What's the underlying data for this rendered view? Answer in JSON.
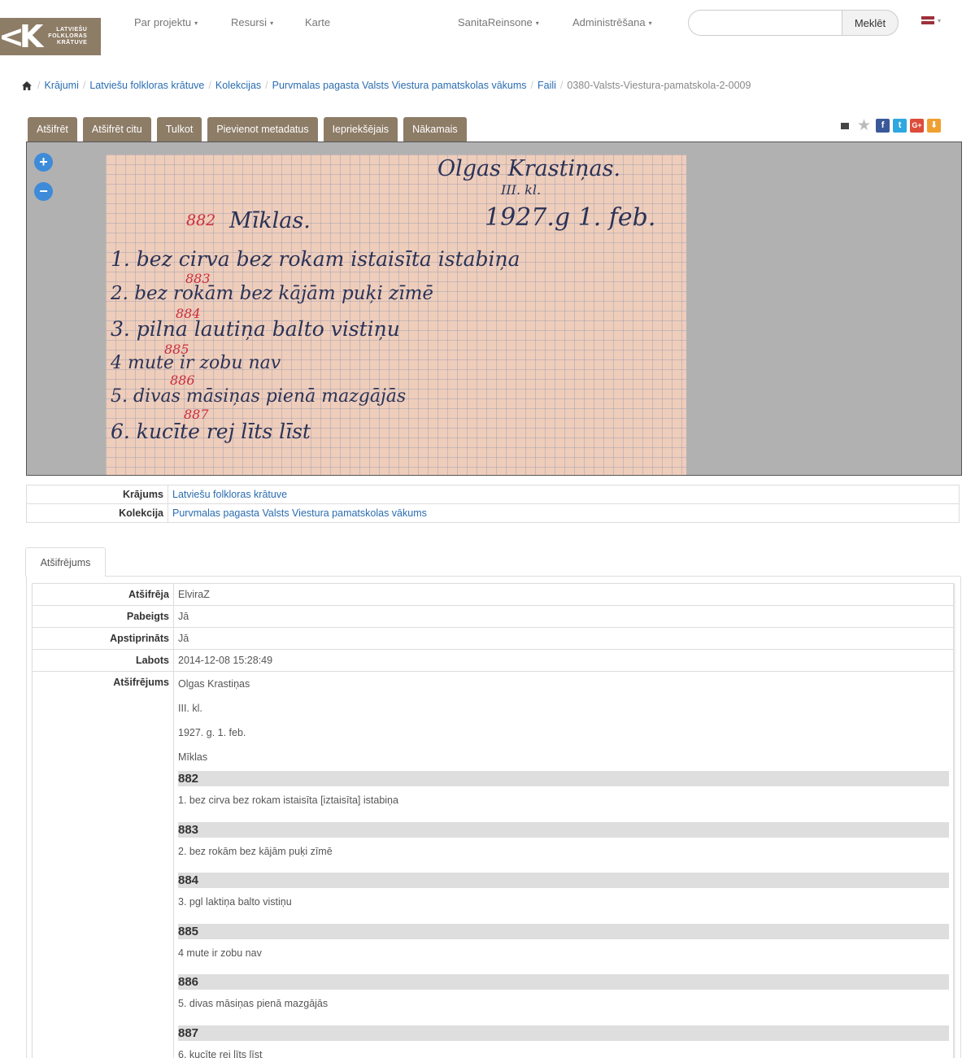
{
  "nav": {
    "logo_text_1": "LATVIEŠU",
    "logo_text_2": "FOLKLORAS",
    "logo_text_3": "KRĀTUVE",
    "items": [
      "Par projektu",
      "Resursi",
      "Karte"
    ],
    "user": "SanitaReinsone",
    "admin": "Administrēšana",
    "search_placeholder": "",
    "search_button": "Meklēt"
  },
  "breadcrumb": {
    "items": [
      "Krājumi",
      "Latviešu folkloras krātuve",
      "Kolekcijas",
      "Purvmalas pagasta Valsts Viestura pamatskolas vākums",
      "Faili"
    ],
    "current": "0380-Valsts-Viestura-pamatskola-2-0009"
  },
  "actions": [
    "Atšifrēt",
    "Atšifrēt citu",
    "Tulkot",
    "Pievienot metadatus",
    "Iepriekšējais",
    "Nākamais"
  ],
  "share": {
    "facebook": "f",
    "twitter": "t",
    "google": "G+"
  },
  "viewer": {
    "zoom_in": "+",
    "zoom_out": "−",
    "manuscript": {
      "name": "Olgas Krastiņas.",
      "class": "III. kl.",
      "date": "1927.g 1. feb.",
      "heading": "Mīklas.",
      "heading_num": "882",
      "lines": [
        "1. bez cirva bez rokam istaisīta istabiņa",
        "2. bez rokām bez kājām puķi zīmē",
        "3. pilna lautiņa balto vistiņu",
        "4 mute ir zobu nav",
        "5. divas māsiņas pienā mazgājās",
        "6. kucīte rej līts līst"
      ],
      "red_nums": [
        "883",
        "884",
        "885",
        "886",
        "887"
      ]
    }
  },
  "info": [
    {
      "label": "Krājums",
      "value": "Latviešu folkloras krātuve"
    },
    {
      "label": "Kolekcija",
      "value": "Purvmalas pagasta Valsts Viestura pamatskolas vākums"
    }
  ],
  "tab": "Atšifrējums",
  "transcription": {
    "fields": [
      {
        "label": "Atšifrēja",
        "value": "ElviraZ"
      },
      {
        "label": "Pabeigts",
        "value": "Jā"
      },
      {
        "label": "Apstiprināts",
        "value": "Jā"
      },
      {
        "label": "Labots",
        "value": "2014-12-08 15:28:49"
      }
    ],
    "text_label": "Atšifrējums",
    "header_lines": [
      "Olgas Krastiņas",
      "III. kl.",
      "1927. g. 1. feb.",
      "Mīklas"
    ],
    "riddles": [
      {
        "num": "882",
        "text": "1. bez cirva bez rokam istaisīta [iztaisīta] istabiņa"
      },
      {
        "num": "883",
        "text": "2. bez rokām bez kājām puķi zīmē"
      },
      {
        "num": "884",
        "text": "3. pgl laktiņa balto vistiņu"
      },
      {
        "num": "885",
        "text": "4 mute ir zobu nav"
      },
      {
        "num": "886",
        "text": "5. divas māsiņas pienā mazgājās"
      },
      {
        "num": "887",
        "text": "6. kucīte rej līts līst"
      }
    ]
  }
}
